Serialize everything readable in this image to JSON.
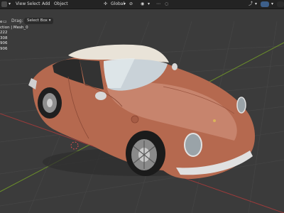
{
  "menu": {
    "view": "View",
    "select": "Select",
    "add": "Add",
    "object": "Object"
  },
  "toolbar": {
    "drag_label": "Drag:",
    "select_mode": "Select Box",
    "orientation": "Global"
  },
  "stats": {
    "line1": "e",
    "line2": "ction | Mesh_0",
    "line3": "222",
    "line4": "308",
    "line5": "906",
    "line6": "906"
  },
  "colors": {
    "viewport_bg": "#3b3b3b",
    "header_bg": "#232323",
    "car_body": "#b5694f",
    "x_axis": "#9a3b3b",
    "y_axis": "#6b8f2a"
  }
}
